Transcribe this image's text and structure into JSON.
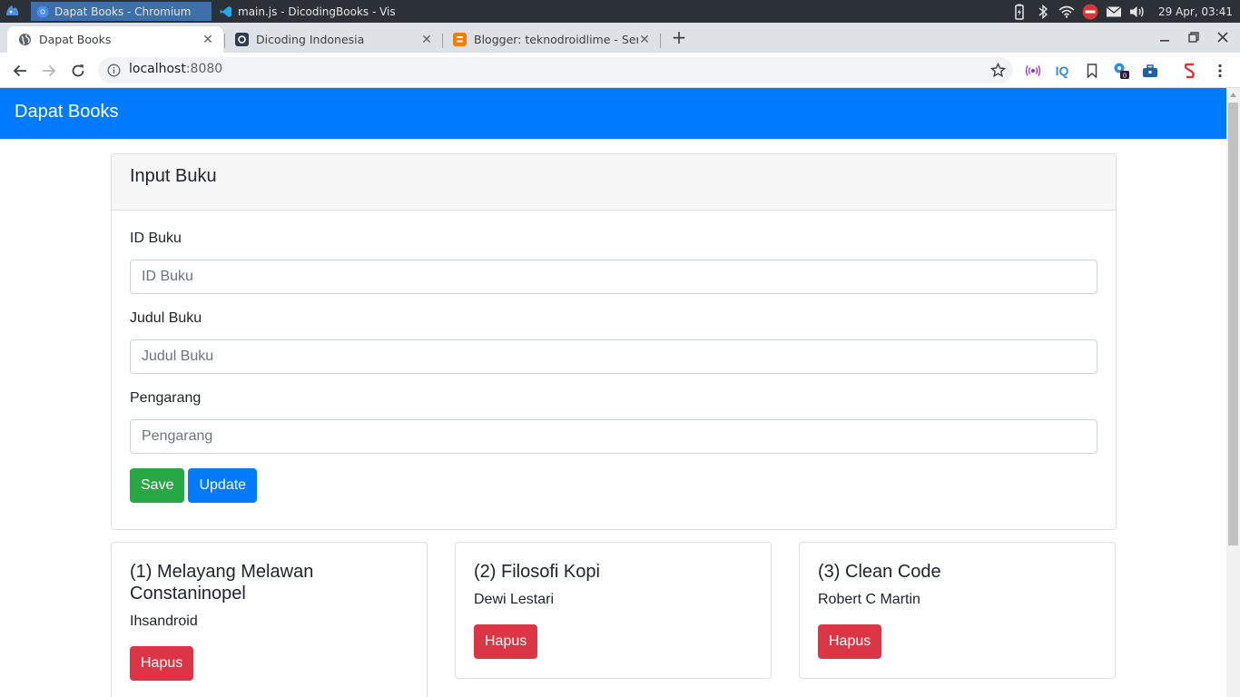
{
  "taskbar": {
    "tasks": [
      {
        "label": "Dapat Books - Chromium",
        "icon": "chromium-icon",
        "active": true
      },
      {
        "label": "main.js - DicodingBooks - Vis...",
        "icon": "vscode-icon",
        "active": false
      }
    ],
    "clock": "29 Apr, 03:41"
  },
  "browser": {
    "tabs": [
      {
        "label": "Dapat Books",
        "icon": "globe-icon"
      },
      {
        "label": "Dicoding Indonesia",
        "icon": "dicoding-icon"
      },
      {
        "label": "Blogger: teknodroidlime - Semu",
        "icon": "blogger-icon"
      }
    ],
    "url_host": "localhost",
    "url_port": ":8080"
  },
  "app": {
    "brand": "Dapat Books",
    "form": {
      "title": "Input Buku",
      "id_label": "ID Buku",
      "id_placeholder": "ID Buku",
      "title_label": "Judul Buku",
      "title_placeholder": "Judul Buku",
      "author_label": "Pengarang",
      "author_placeholder": "Pengarang",
      "save_label": "Save",
      "update_label": "Update"
    },
    "books": [
      {
        "title": "(1) Melayang Melawan Constaninopel",
        "author": "Ihsandroid",
        "delete_label": "Hapus"
      },
      {
        "title": "(2) Filosofi Kopi",
        "author": "Dewi Lestari",
        "delete_label": "Hapus"
      },
      {
        "title": "(3) Clean Code",
        "author": "Robert C Martin",
        "delete_label": "Hapus"
      }
    ]
  },
  "colors": {
    "primary": "#007bff",
    "success": "#28a745",
    "danger": "#dc3545"
  }
}
